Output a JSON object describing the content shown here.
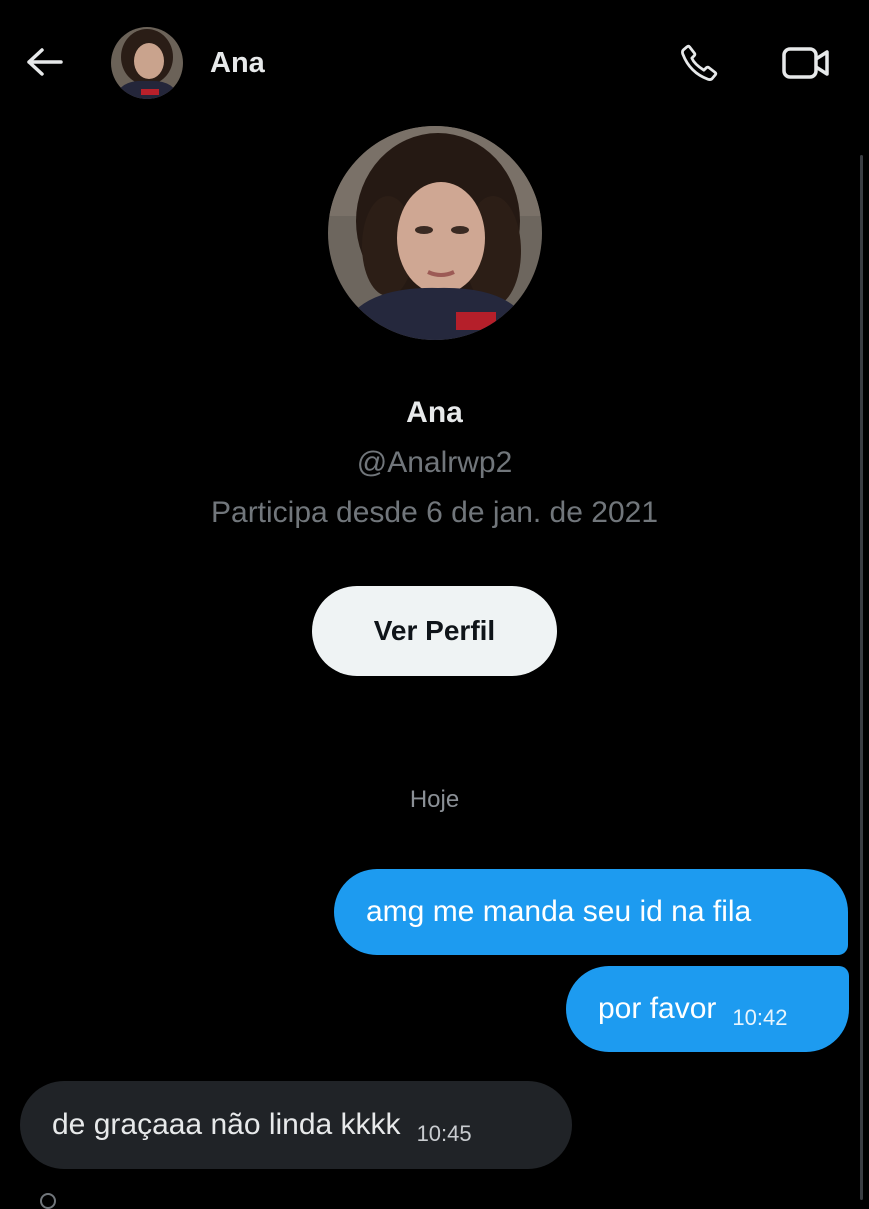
{
  "header": {
    "title": "Ana",
    "back_icon": "arrow-left-icon",
    "call_icon": "phone-icon",
    "video_icon": "video-camera-icon"
  },
  "profile": {
    "name": "Ana",
    "handle": "@Analrwp2",
    "joined": "Participa desde 6 de jan. de 2021",
    "button_label": "Ver Perfil"
  },
  "conversation": {
    "date_separator": "Hoje",
    "messages": [
      {
        "direction": "outgoing",
        "text": "amg me manda seu id na fila",
        "time": ""
      },
      {
        "direction": "outgoing",
        "text": "por favor",
        "time": "10:42"
      },
      {
        "direction": "incoming",
        "text": "de graçaaa não linda kkkk",
        "time": "10:45"
      }
    ]
  },
  "colors": {
    "background": "#000000",
    "outgoing_bubble": "#1d9bf0",
    "incoming_bubble": "#202327",
    "secondary_text": "#71767b",
    "button_bg": "#eff3f4"
  }
}
